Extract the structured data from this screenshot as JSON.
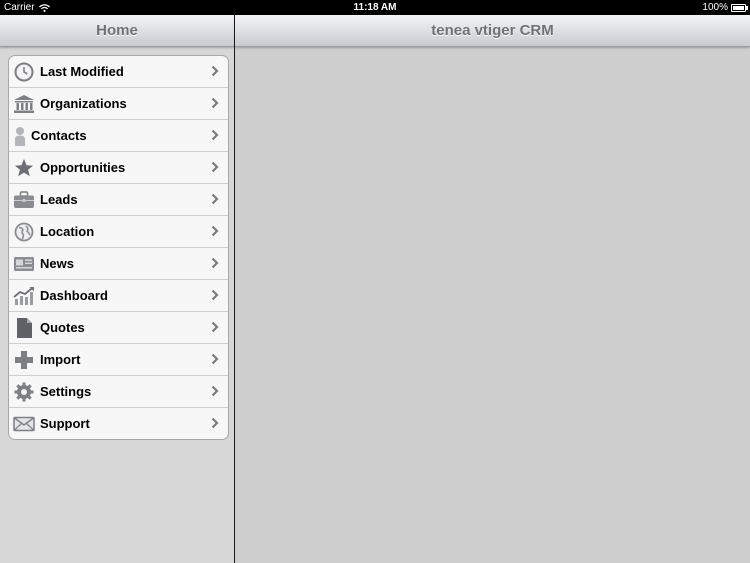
{
  "status_bar": {
    "carrier": "Carrier",
    "time": "11:18 AM",
    "battery": "100%"
  },
  "master": {
    "title": "Home",
    "items": [
      {
        "label": "Last Modified",
        "icon": "clock-icon"
      },
      {
        "label": "Organizations",
        "icon": "building-icon"
      },
      {
        "label": "Contacts",
        "icon": "person-icon"
      },
      {
        "label": "Opportunities",
        "icon": "star-icon"
      },
      {
        "label": "Leads",
        "icon": "briefcase-icon"
      },
      {
        "label": "Location",
        "icon": "globe-icon"
      },
      {
        "label": "News",
        "icon": "newspaper-icon"
      },
      {
        "label": "Dashboard",
        "icon": "chart-icon"
      },
      {
        "label": "Quotes",
        "icon": "document-icon"
      },
      {
        "label": "Import",
        "icon": "plus-icon"
      },
      {
        "label": "Settings",
        "icon": "gear-icon"
      },
      {
        "label": "Support",
        "icon": "envelope-icon"
      }
    ]
  },
  "detail": {
    "title": "tenea vtiger CRM"
  },
  "colors": {
    "icon_gray": "#7d7f83",
    "chevron": "#7a7a7a",
    "nav_title": "#6f7275"
  }
}
